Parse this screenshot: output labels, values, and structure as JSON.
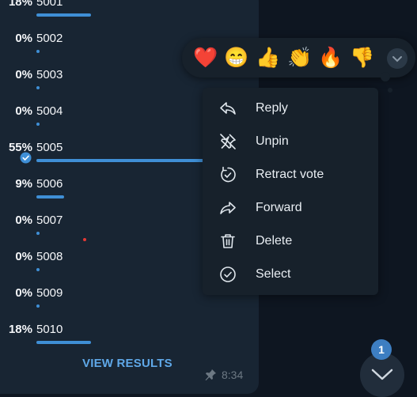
{
  "poll": {
    "options": [
      {
        "percent": "18%",
        "label": "5001",
        "share": 0.18
      },
      {
        "percent": "0%",
        "label": "5002",
        "share": 0.0
      },
      {
        "percent": "0%",
        "label": "5003",
        "share": 0.0
      },
      {
        "percent": "0%",
        "label": "5004",
        "share": 0.0
      },
      {
        "percent": "55%",
        "label": "5005",
        "share": 0.55,
        "voted": true
      },
      {
        "percent": "9%",
        "label": "5006",
        "share": 0.09
      },
      {
        "percent": "0%",
        "label": "5007",
        "share": 0.0
      },
      {
        "percent": "0%",
        "label": "5008",
        "share": 0.0
      },
      {
        "percent": "0%",
        "label": "5009",
        "share": 0.0
      },
      {
        "percent": "18%",
        "label": "5010",
        "share": 0.18
      }
    ],
    "view_results_label": "VIEW RESULTS",
    "time": "8:34"
  },
  "reactions": [
    "❤️",
    "😁",
    "👍",
    "👏",
    "🔥",
    "👎"
  ],
  "menu": {
    "reply": "Reply",
    "unpin": "Unpin",
    "retract_vote": "Retract vote",
    "forward": "Forward",
    "delete": "Delete",
    "select": "Select"
  },
  "unread_badge": "1",
  "colors": {
    "accent": "#3f8fd6",
    "background": "#0e1621",
    "bubble": "#182533"
  }
}
